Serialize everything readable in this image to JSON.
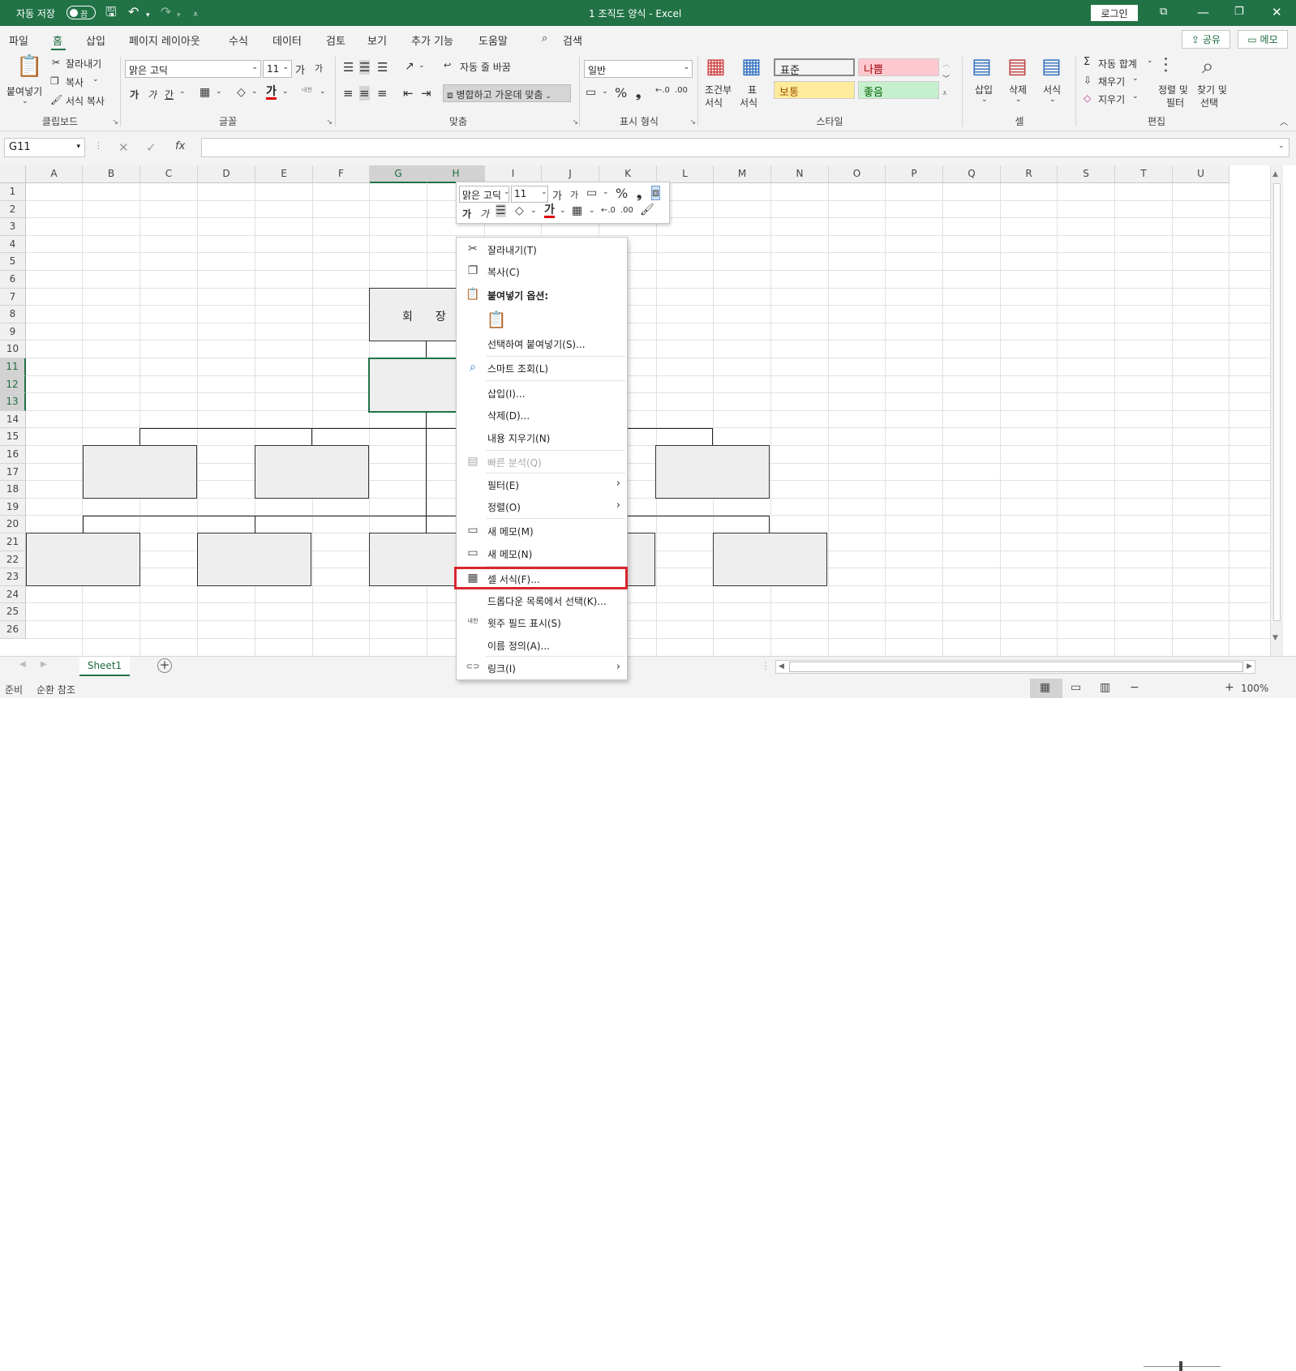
{
  "titlebar": {
    "autosave_label": "자동 저장",
    "autosave_state": "끔",
    "doc_title": "1 조직도 양식  -  Excel",
    "login_label": "로그인"
  },
  "menu": {
    "tabs": [
      "파일",
      "홈",
      "삽입",
      "페이지 레이아웃",
      "수식",
      "데이터",
      "검토",
      "보기",
      "추가 기능",
      "도움말",
      "검색"
    ],
    "active_tab": "홈",
    "share_label": "공유",
    "memo_label": "메모"
  },
  "ribbon": {
    "clipboard": {
      "label": "클립보드",
      "paste": "붙여넣기",
      "cut": "잘라내기",
      "copy": "복사",
      "format_painter": "서식 복사"
    },
    "font": {
      "label": "글꼴",
      "font_name": "맑은 고딕",
      "font_size": "11",
      "grow": "가",
      "shrink": "가",
      "bold": "가",
      "italic": "가",
      "underline": "간",
      "font_color": "가",
      "phonetic": "내천"
    },
    "alignment": {
      "label": "맞춤",
      "wrap_text": "자동 줄 바꿈",
      "merge_center": "병합하고 가운데 맞춤"
    },
    "number": {
      "label": "표시 형식",
      "format": "일반",
      "percent": "%",
      "comma": "❟"
    },
    "styles": {
      "label": "스타일",
      "conditional": "조건부",
      "conditional2": "서식",
      "table": "표",
      "table2": "서식",
      "normal": "표준",
      "bad": "나쁨",
      "neutral": "보통",
      "good": "좋음",
      "colors": {
        "normal_bg": "#ffffff",
        "bad_bg": "#ffc7ce",
        "bad_fg": "#9c0006",
        "neutral_bg": "#ffeb9c",
        "neutral_fg": "#9c5700",
        "good_bg": "#c6efce",
        "good_fg": "#006100"
      }
    },
    "cells": {
      "label": "셀",
      "insert": "삽입",
      "delete": "삭제",
      "format": "서식"
    },
    "editing": {
      "label": "편집",
      "autosum": "자동 합계",
      "fill": "채우기",
      "clear": "지우기",
      "sort": "정렬 및",
      "sort2": "필터",
      "find": "찾기 및",
      "find2": "선택"
    }
  },
  "formula_bar": {
    "name_box": "G11",
    "fx": "fx",
    "formula": ""
  },
  "grid": {
    "columns": [
      "A",
      "B",
      "C",
      "D",
      "E",
      "F",
      "G",
      "H",
      "I",
      "J",
      "K",
      "L",
      "M",
      "N",
      "O",
      "P",
      "Q",
      "R",
      "S",
      "T",
      "U"
    ],
    "rows": [
      "1",
      "2",
      "3",
      "4",
      "5",
      "6",
      "7",
      "8",
      "9",
      "10",
      "11",
      "12",
      "13",
      "14",
      "15",
      "16",
      "17",
      "18",
      "19",
      "20",
      "21",
      "22",
      "23",
      "24",
      "25",
      "26"
    ],
    "selected_columns": [
      "G",
      "H"
    ],
    "selected_rows": [
      "11",
      "12",
      "13"
    ],
    "cell_text": "회장"
  },
  "sheet": {
    "tab_name": "Sheet1",
    "add_icon": "+"
  },
  "status": {
    "ready": "준비",
    "circular": "순환 참조",
    "zoom": "100%",
    "minus": "−",
    "plus": "+"
  },
  "mini_toolbar": {
    "font": "맑은 고딕",
    "size": "11",
    "grow": "가",
    "shrink": "가",
    "bold": "가",
    "italic": "가",
    "percent": "%",
    "comma": "❟",
    "font_color": "가"
  },
  "context_menu": {
    "items": [
      {
        "label": "잘라내기(T)",
        "icon": "✂"
      },
      {
        "label": "복사(C)",
        "icon": "❐"
      },
      {
        "label": "붙여넣기 옵션:",
        "icon": "📋"
      },
      {
        "label": "선택하여 붙여넣기(S)...",
        "icon": ""
      },
      {
        "label": "스마트 조회(L)",
        "icon": "⌕"
      },
      {
        "label": "삽입(I)...",
        "icon": ""
      },
      {
        "label": "삭제(D)...",
        "icon": ""
      },
      {
        "label": "내용 지우기(N)",
        "icon": ""
      },
      {
        "label": "빠른 분석(Q)",
        "icon": "▤"
      },
      {
        "label": "필터(E)",
        "icon": ""
      },
      {
        "label": "정렬(O)",
        "icon": ""
      },
      {
        "label": "새 메모(M)",
        "icon": "▭"
      },
      {
        "label": "새 메모(N)",
        "icon": "▭"
      },
      {
        "label": "셀 서식(F)...",
        "icon": "▦"
      },
      {
        "label": "드롭다운 목록에서 선택(K)...",
        "icon": ""
      },
      {
        "label": "윗주 필드 표시(S)",
        "icon": "내천"
      },
      {
        "label": "이름 정의(A)...",
        "icon": ""
      },
      {
        "label": "링크(I)",
        "icon": "⊂⊃"
      }
    ],
    "submenu_arrow": "›",
    "paste_icon": "📋"
  }
}
